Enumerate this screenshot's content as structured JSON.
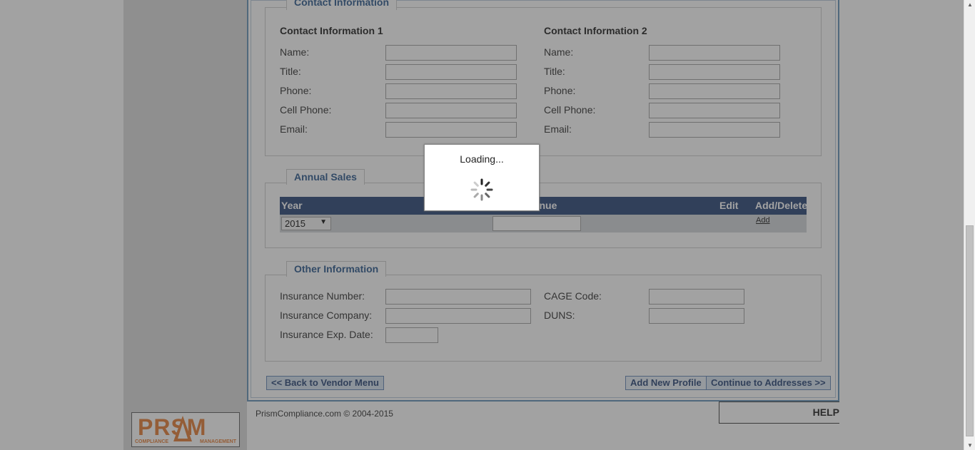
{
  "contact_section": {
    "legend": "Contact Information",
    "col1": {
      "header": "Contact Information 1",
      "labels": [
        "Name:",
        "Title:",
        "Phone:",
        "Cell Phone:",
        "Email:"
      ]
    },
    "col2": {
      "header": "Contact Information 2",
      "labels": [
        "Name:",
        "Title:",
        "Phone:",
        "Cell Phone:",
        "Email:"
      ]
    }
  },
  "annual_sales": {
    "legend": "Annual Sales",
    "columns": {
      "year": "Year",
      "revenue": "Revenue",
      "edit": "Edit",
      "add_delete": "Add/Delete"
    },
    "year_value": "2015",
    "add_link": "Add"
  },
  "other_info": {
    "legend": "Other Information",
    "labels": {
      "insurance_number": "Insurance Number:",
      "insurance_company": "Insurance Company:",
      "insurance_exp_date": "Insurance Exp. Date:",
      "cage_code": "CAGE Code:",
      "duns": "DUNS:"
    }
  },
  "buttons": {
    "back": "<< Back to Vendor Menu",
    "add_profile": "Add New Profile",
    "continue": "Continue to Addresses >>"
  },
  "footer": {
    "copyright": "PrismCompliance.com © 2004-2015",
    "help": "HELP"
  },
  "logo": {
    "text": "PRSM",
    "sub_left": "COMPLIANCE",
    "sub_right": "MANAGEMENT"
  },
  "loading": {
    "text": "Loading..."
  },
  "colors": {
    "accent": "#1c3a6e",
    "legend_text": "#1f4f87",
    "logo": "#e27428",
    "frame_border": "#5a8ab3"
  }
}
